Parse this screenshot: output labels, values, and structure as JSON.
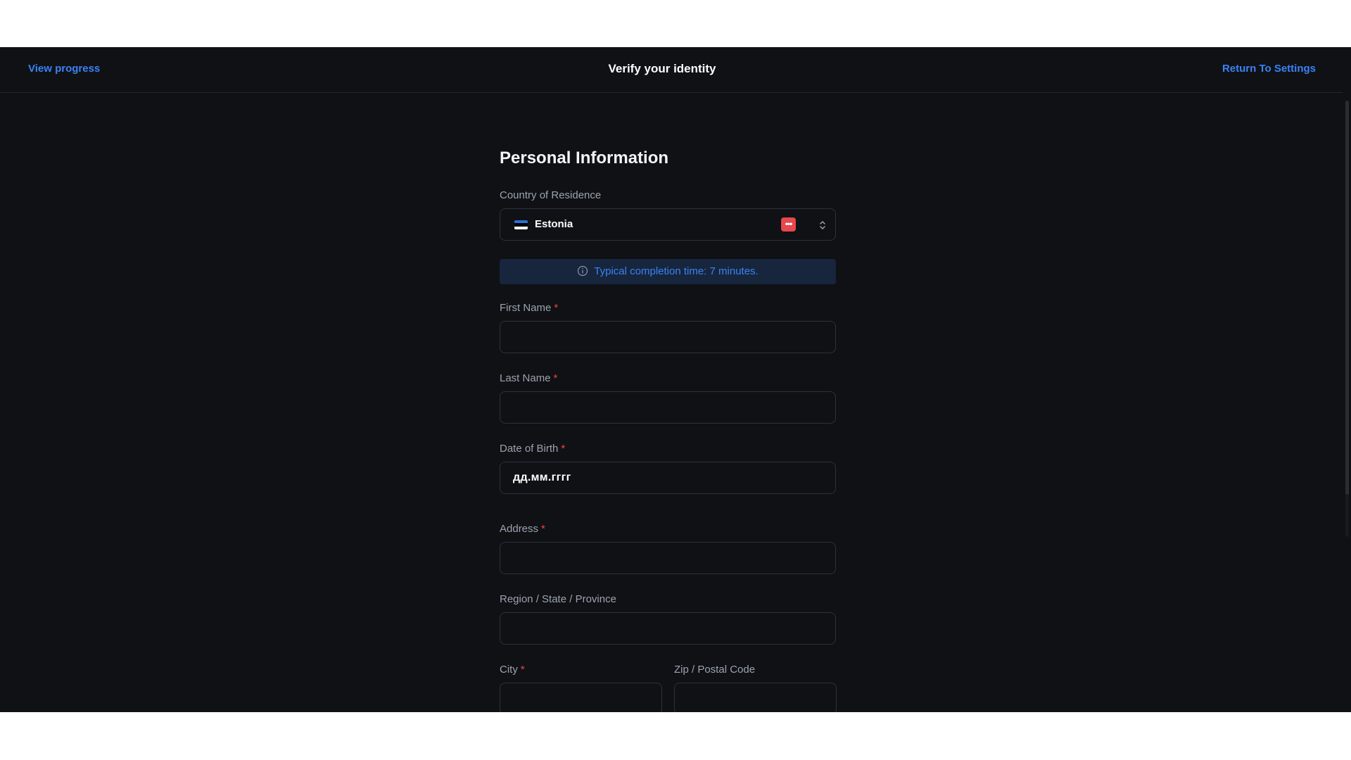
{
  "header": {
    "left_link": "View progress",
    "title": "Verify your identity",
    "right_link": "Return To Settings"
  },
  "form": {
    "heading": "Personal Information",
    "country": {
      "label": "Country of Residence",
      "value": "Estonia",
      "flag_colors": [
        "#2b6fd6",
        "#000000",
        "#ffffff"
      ],
      "icons": [
        "password-manager-icon",
        "chevron-up-down-icon"
      ]
    },
    "banner": {
      "icon": "info-icon",
      "text": "Typical completion time: 7 minutes."
    },
    "required_marker": "*",
    "fields": {
      "first_name": {
        "label": "First Name",
        "value": ""
      },
      "last_name": {
        "label": "Last Name",
        "value": ""
      },
      "dob": {
        "label": "Date of Birth",
        "value": "дд.мм.гггг"
      },
      "address": {
        "label": "Address",
        "value": ""
      },
      "region": {
        "label": "Region / State / Province",
        "value": ""
      },
      "city": {
        "label": "City",
        "value": ""
      },
      "zip": {
        "label": "Zip / Postal Code",
        "value": ""
      }
    }
  },
  "colors": {
    "background": "#0f1115",
    "accent": "#3b82f6",
    "required": "#ef4444",
    "banner_bg": "#17263d"
  }
}
